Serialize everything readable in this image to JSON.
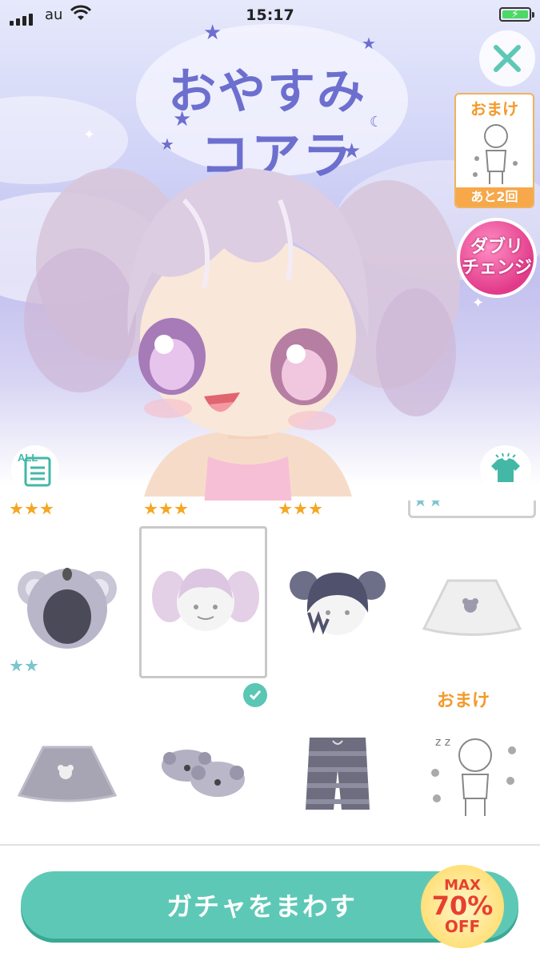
{
  "status_bar": {
    "carrier": "au",
    "time": "15:17"
  },
  "banner": {
    "title_line1": "おやすみ",
    "title_line2": "コアラ",
    "bonus_card": {
      "label": "おまけ",
      "remaining": "あと2回"
    },
    "double_change": {
      "line1": "ダブリ",
      "line2": "チェンジ"
    }
  },
  "controls": {
    "all_label": "ALL"
  },
  "grid": {
    "top_rarities": [
      {
        "stars": 3,
        "color": "gold"
      },
      {
        "stars": 3,
        "color": "gold"
      },
      {
        "stars": 3,
        "color": "gold"
      },
      {
        "stars": 2,
        "color": "blue"
      }
    ],
    "items": [
      {
        "name": "koala-hood",
        "rarity_stars": 2,
        "rarity_color": "blue"
      },
      {
        "name": "pigtail-hair",
        "selected": true
      },
      {
        "name": "dark-hair-koala-ears"
      },
      {
        "name": "white-koala-skirt"
      },
      {
        "name": "gray-koala-skirt"
      },
      {
        "name": "koala-slippers"
      },
      {
        "name": "striped-shorts"
      },
      {
        "name": "bonus-pose",
        "label": "おまけ"
      }
    ]
  },
  "gacha": {
    "button_label": "ガチャをまわす",
    "discount": {
      "max": "MAX",
      "percent": "70%",
      "off": "OFF"
    }
  },
  "colors": {
    "accent_teal": "#5ec8b6",
    "title_purple": "#6d6fcf",
    "bonus_orange": "#f39a2b",
    "discount_red": "#e8402e"
  }
}
